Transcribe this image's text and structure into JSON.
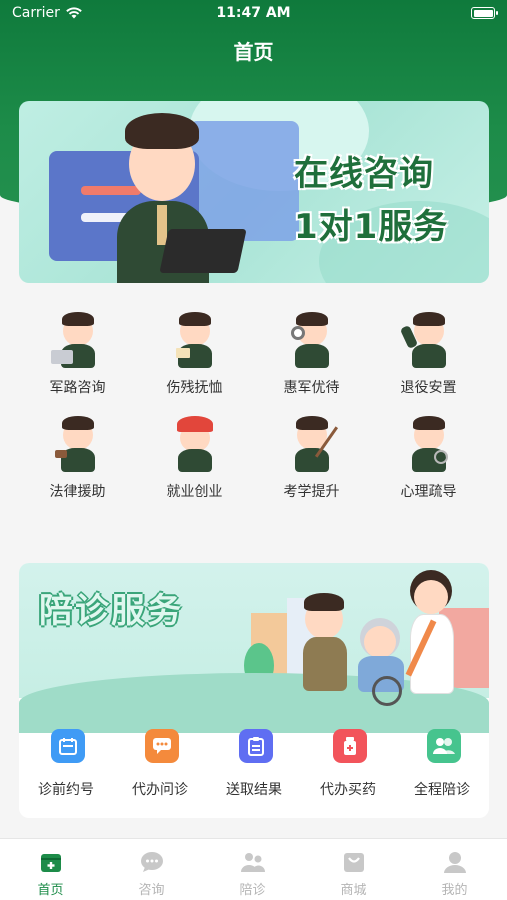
{
  "status_bar": {
    "carrier": "Carrier",
    "time": "11:47 AM"
  },
  "header": {
    "title": "首页"
  },
  "banner": {
    "line1": "在线咨询",
    "line2": "1对1服务"
  },
  "services": [
    {
      "label": "军路咨询",
      "icon": "soldier-laptop-icon"
    },
    {
      "label": "伤残抚恤",
      "icon": "soldier-document-icon"
    },
    {
      "label": "惠军优待",
      "icon": "soldier-magnifier-icon"
    },
    {
      "label": "退役安置",
      "icon": "soldier-salute-icon"
    },
    {
      "label": "法律援助",
      "icon": "soldier-gavel-icon"
    },
    {
      "label": "就业创业",
      "icon": "worker-helmet-icon"
    },
    {
      "label": "考学提升",
      "icon": "soldier-pointer-icon"
    },
    {
      "label": "心理疏导",
      "icon": "soldier-stethoscope-icon"
    }
  ],
  "accompany": {
    "title": "陪诊服务",
    "items": [
      {
        "label": "诊前约号",
        "icon": "calendar-icon",
        "color": "#3f9bf5"
      },
      {
        "label": "代办问诊",
        "icon": "chat-icon",
        "color": "#f48a3c"
      },
      {
        "label": "送取结果",
        "icon": "clipboard-icon",
        "color": "#5f6ef2"
      },
      {
        "label": "代办买药",
        "icon": "medicine-icon",
        "color": "#f2545b"
      },
      {
        "label": "全程陪诊",
        "icon": "people-icon",
        "color": "#46c48e"
      }
    ]
  },
  "tabbar": {
    "active_color": "#1d8c49",
    "inactive_color": "#b5b5b5",
    "tabs": [
      {
        "label": "首页",
        "icon": "home-icon"
      },
      {
        "label": "咨询",
        "icon": "consult-icon"
      },
      {
        "label": "陪诊",
        "icon": "accompany-icon"
      },
      {
        "label": "商城",
        "icon": "shop-icon"
      },
      {
        "label": "我的",
        "icon": "profile-icon"
      }
    ]
  }
}
